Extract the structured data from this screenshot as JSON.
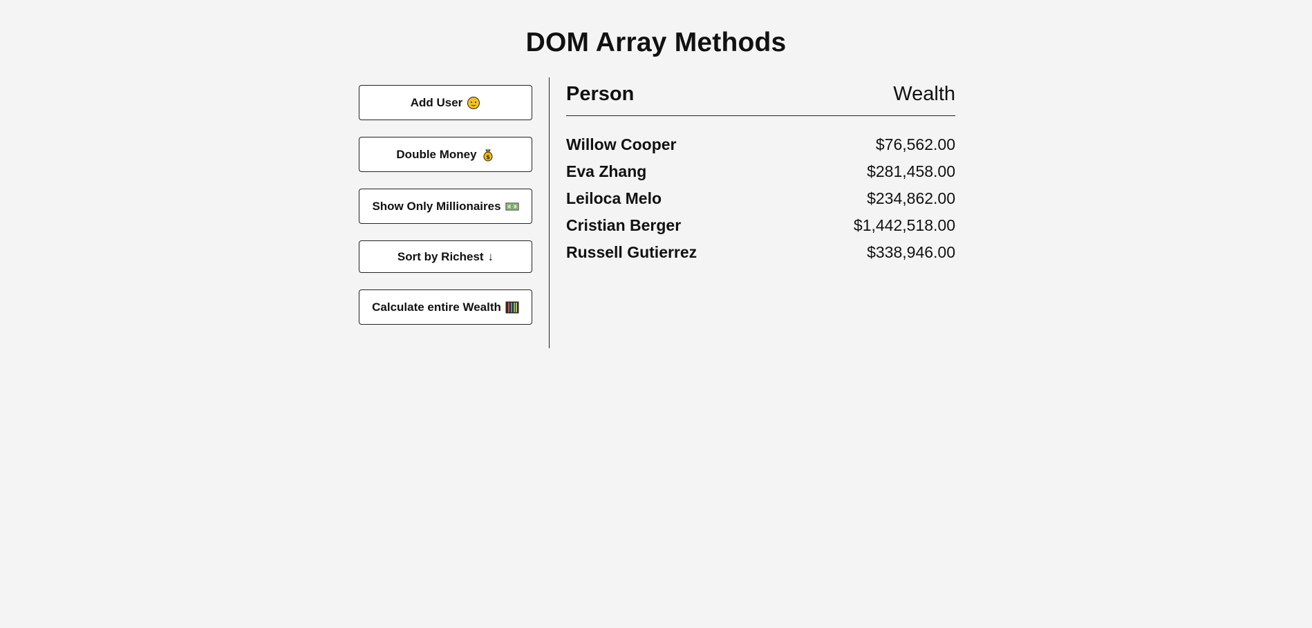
{
  "page": {
    "title": "DOM Array Methods"
  },
  "actions": {
    "add_user": "Add User",
    "double_money": "Double Money",
    "show_millionaires": "Show Only Millionaires",
    "sort_richest": "Sort by Richest",
    "sort_arrow": "↓",
    "calculate_wealth": "Calculate entire Wealth"
  },
  "icons": {
    "add_user": "face-emoji-icon",
    "double_money": "money-bag-icon",
    "show_millionaires": "banknote-icon",
    "calculate_wealth": "abacus-icon"
  },
  "table": {
    "headers": {
      "person": "Person",
      "wealth": "Wealth"
    },
    "rows": [
      {
        "name": "Willow Cooper",
        "wealth": "$76,562.00"
      },
      {
        "name": "Eva Zhang",
        "wealth": "$281,458.00"
      },
      {
        "name": "Leiloca Melo",
        "wealth": "$234,862.00"
      },
      {
        "name": "Cristian Berger",
        "wealth": "$1,442,518.00"
      },
      {
        "name": "Russell Gutierrez",
        "wealth": "$338,946.00"
      }
    ]
  }
}
